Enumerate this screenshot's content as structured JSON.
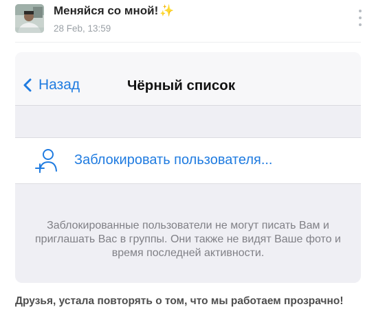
{
  "post": {
    "author": "Меняйся со мной!",
    "author_emoji": "✨",
    "timestamp": "28 Feb, 13:59",
    "text": "Друзья, устала повторять о том, что мы работаем прозрачно!"
  },
  "screenshot": {
    "back_label": "Назад",
    "title": "Чёрный список",
    "block_user_label": "Заблокировать пользователя...",
    "info_text": "Заблокированные пользователи не могут писать Вам и приглашать Вас в группы. Они также не видят Ваше фото и время последней активности."
  },
  "colors": {
    "ios_blue": "#1f7be0",
    "sparkle": "#f5c24a"
  },
  "icons": [
    "avatar-photo",
    "more-vertical-icon",
    "chevron-left-icon",
    "add-user-icon"
  ]
}
